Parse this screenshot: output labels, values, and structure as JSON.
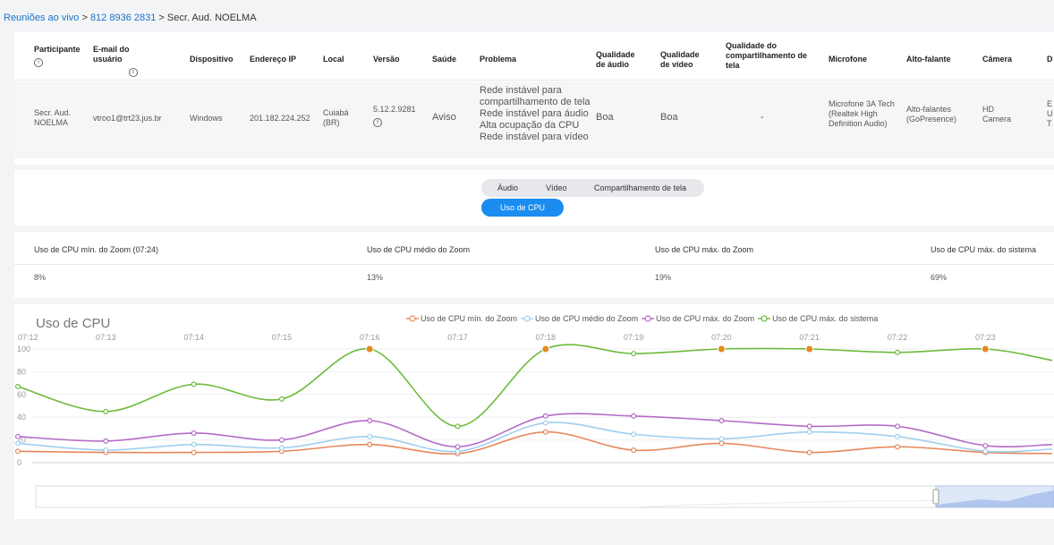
{
  "breadcrumb": {
    "link1": "Reuniões ao vivo",
    "sep1": " > ",
    "link2": "812 8936 2831",
    "sep2": " > ",
    "current": "Secr. Aud. NOELMA"
  },
  "table": {
    "headers": {
      "participante": "Participante",
      "email": "E-mail do usuário",
      "dispositivo": "Dispositivo",
      "ip": "Endereço IP",
      "local": "Local",
      "versao": "Versão",
      "saude": "Saúde",
      "problema": "Problema",
      "qual_audio_1": "Qualidade",
      "qual_audio_2": "de áudio",
      "qual_video_1": "Qualidade",
      "qual_video_2": "de vídeo",
      "qual_comp_1": "Qualidade do",
      "qual_comp_2": "compartilhamento de",
      "qual_comp_3": "tela",
      "microfone": "Microfone",
      "alto_falante": "Alto-falante",
      "camera": "Câmera",
      "next": "D"
    },
    "row": {
      "participante_1": "Secr. Aud.",
      "participante_2": "NOELMA",
      "email": "vtroo1@trt23.jus.br",
      "dispositivo": "Windows",
      "ip": "201.182.224.252",
      "local_1": "Cuiabá",
      "local_2": "(BR)",
      "versao": "5.12.2.9281",
      "saude": "Aviso",
      "problemas": [
        "Rede instável para",
        "compartilhamento de tela",
        "Rede instável para áudio",
        "Alta ocupação da CPU",
        "Rede instável para vídeo"
      ],
      "qual_audio": "Boa",
      "qual_video": "Boa",
      "qual_comp": "-",
      "microfone_1": "Microfone 3A Tech",
      "microfone_2": "(Realtek High",
      "microfone_3": "Definition Audio)",
      "alto_falante_1": "Alto-falantes",
      "alto_falante_2": "(GoPresence)",
      "camera_1": "HD",
      "camera_2": "Camera",
      "next_1": "E",
      "next_2": "U",
      "next_3": "T"
    }
  },
  "tabs": {
    "audio": "Áudio",
    "video": "Vídeo",
    "compartilhamento": "Compartilhamento de tela",
    "cpu": "Uso de CPU"
  },
  "stats": {
    "labels": [
      "Uso de CPU mín. do Zoom (07:24)",
      "Uso de CPU médio do Zoom",
      "Uso de CPU máx. do Zoom",
      "Uso de CPU máx. do sistema"
    ],
    "values": [
      "8%",
      "13%",
      "19%",
      "69%"
    ]
  },
  "chart_title": "Uso de CPU",
  "chart_data": {
    "type": "line",
    "title": "Uso de CPU",
    "categories": [
      "07:12",
      "07:13",
      "07:14",
      "07:15",
      "07:16",
      "07:17",
      "07:18",
      "07:19",
      "07:20",
      "07:21",
      "07:22",
      "07:23"
    ],
    "ylim": [
      0,
      100
    ],
    "yticks": [
      "0",
      "20",
      "40",
      "60",
      "80",
      "100"
    ],
    "legend_position": "top-center",
    "series": [
      {
        "name": "Uso de CPU mín. do Zoom",
        "color": "#e8875a",
        "values": [
          10,
          9,
          9,
          10,
          16,
          8,
          27,
          11,
          17,
          9,
          14,
          9,
          8
        ]
      },
      {
        "name": "Uso de CPU médio do Zoom",
        "color": "#9fcfef",
        "values": [
          17,
          11,
          16,
          13,
          23,
          10,
          35,
          25,
          21,
          27,
          23,
          10,
          12
        ]
      },
      {
        "name": "Uso de CPU máx. do Zoom",
        "color": "#b46bc8",
        "values": [
          23,
          19,
          26,
          20,
          37,
          14,
          41,
          41,
          37,
          32,
          32,
          15,
          16
        ]
      },
      {
        "name": "Uso de CPU máx. do sistema",
        "color": "#6cbb3c",
        "values": [
          67,
          45,
          69,
          56,
          100,
          32,
          100,
          96,
          100,
          100,
          97,
          100,
          90
        ]
      }
    ],
    "highlighted_points": [
      "07:16",
      "07:18",
      "07:20",
      "07:21",
      "07:23"
    ],
    "highlight_color": "#e38a1e"
  }
}
